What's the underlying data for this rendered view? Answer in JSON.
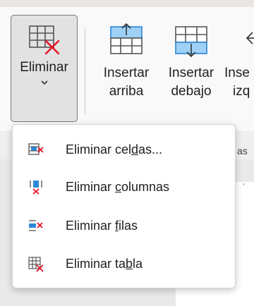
{
  "ribbon": {
    "eliminar": {
      "label": "Eliminar",
      "icon": "table-delete-icon",
      "chevron": "chevron-down-icon"
    },
    "insertar_arriba": {
      "line1": "Insertar",
      "line2": "arriba",
      "icon": "insert-row-above-icon"
    },
    "insertar_debajo": {
      "line1": "Insertar",
      "line2": "debajo",
      "icon": "insert-row-below-icon"
    },
    "insertar_izquierda": {
      "line1": "Inse",
      "line2": "izq",
      "icon": "insert-column-left-icon"
    },
    "group_label_fragment": "as"
  },
  "menu": {
    "items": [
      {
        "pre": "Eliminar cel",
        "key": "d",
        "post": "as...",
        "icon": "delete-cells-icon"
      },
      {
        "pre": "Eliminar ",
        "key": "c",
        "post": "olumnas",
        "icon": "delete-columns-icon"
      },
      {
        "pre": "Eliminar ",
        "key": "f",
        "post": "ilas",
        "icon": "delete-rows-icon"
      },
      {
        "pre": "Eliminar ta",
        "key": "b",
        "post": "la",
        "icon": "delete-table-icon"
      }
    ]
  },
  "colors": {
    "accent_blue": "#2b88d8",
    "delete_red": "#e81123",
    "pressed_bg": "#e2e2e2"
  }
}
